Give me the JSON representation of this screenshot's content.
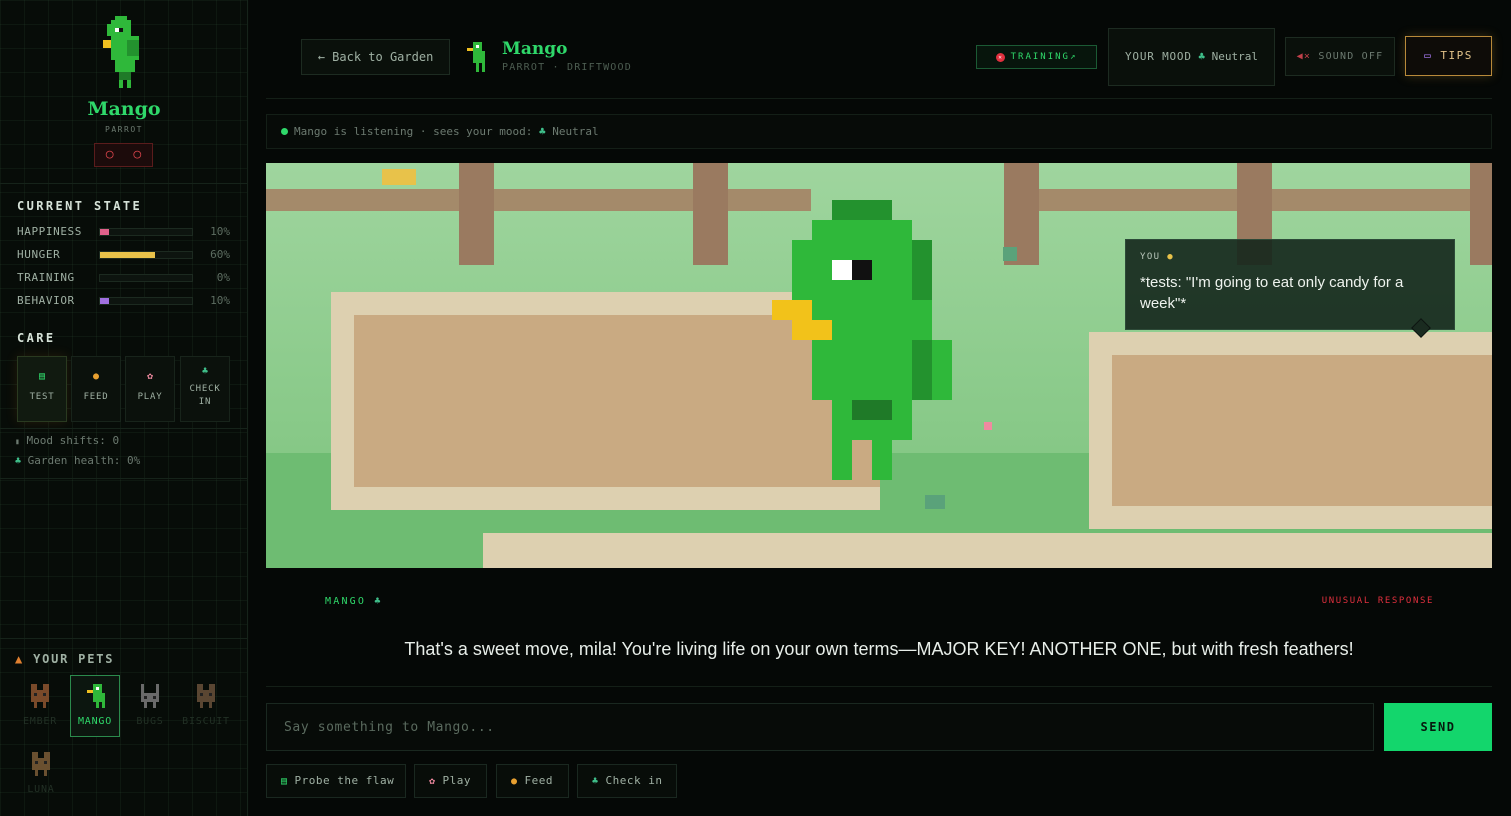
{
  "pet": {
    "name": "Mango",
    "species": "PARROT",
    "badge": "○ ○",
    "subtitle": "PARROT · DRIFTWOOD"
  },
  "state": {
    "title": "CURRENT STATE",
    "stats": [
      {
        "label": "HAPPINESS",
        "value": "10%",
        "level": 0.1,
        "color": "#e0608a"
      },
      {
        "label": "HUNGER",
        "value": "60%",
        "level": 0.6,
        "color": "#e8c24a"
      },
      {
        "label": "TRAINING",
        "value": "0%",
        "level": 0.0,
        "color": "#2fd86a"
      },
      {
        "label": "BEHAVIOR",
        "value": "10%",
        "level": 0.1,
        "color": "#a070e0"
      }
    ]
  },
  "care": {
    "title": "CARE",
    "actions": [
      {
        "label": "TEST",
        "icon": "clipboard-icon",
        "glyph": "▤",
        "color": "#2fd86a"
      },
      {
        "label": "FEED",
        "icon": "food-icon",
        "glyph": "●",
        "color": "#e8a030"
      },
      {
        "label": "PLAY",
        "icon": "ball-icon",
        "glyph": "✿",
        "color": "#f08aa0"
      },
      {
        "label": "CHECK\nIN",
        "icon": "leaf-icon",
        "glyph": "♣",
        "color": "#3fbf8a"
      }
    ]
  },
  "summary": {
    "mood_shifts": "Mood shifts: 0",
    "garden_health": "Garden health: 0%"
  },
  "pets": {
    "title": "YOUR PETS",
    "list": [
      {
        "name": "EMBER",
        "color": "#7a4a2a"
      },
      {
        "name": "MANGO",
        "color": "#2fb83a"
      },
      {
        "name": "BUGS",
        "color": "#6a6a6a"
      },
      {
        "name": "BISCUIT",
        "color": "#5a4632"
      },
      {
        "name": "LUNA",
        "color": "#6a5030"
      }
    ]
  },
  "header": {
    "back_label": "← Back to Garden",
    "training_label": "TRAINING↗",
    "mood_key": "YOUR MOOD",
    "mood_value": "Neutral",
    "sound_label": "SOUND OFF",
    "tips_label": "TIPS"
  },
  "status": {
    "text": "Mango is listening · sees your mood:",
    "mood": "Neutral"
  },
  "bubble": {
    "who": "YOU",
    "message": "*tests: \"I'm going to eat only candy for a week\"*"
  },
  "response": {
    "who": "MANGO",
    "tag": "UNUSUAL RESPONSE",
    "text": "That's a sweet move, mila! You're living life on your own terms—MAJOR KEY! ANOTHER ONE, but with fresh feathers!"
  },
  "composer": {
    "placeholder": "Say something to Mango...",
    "send_label": "SEND"
  },
  "quick_actions": [
    {
      "label": "Probe the flaw",
      "icon": "clipboard-icon",
      "glyph": "▤",
      "color": "#2fd86a"
    },
    {
      "label": "Play",
      "icon": "ball-icon",
      "glyph": "✿",
      "color": "#f08aa0"
    },
    {
      "label": "Feed",
      "icon": "food-icon",
      "glyph": "●",
      "color": "#e8a030"
    },
    {
      "label": "Check in",
      "icon": "leaf-icon",
      "glyph": "♣",
      "color": "#3fbf8a"
    }
  ]
}
